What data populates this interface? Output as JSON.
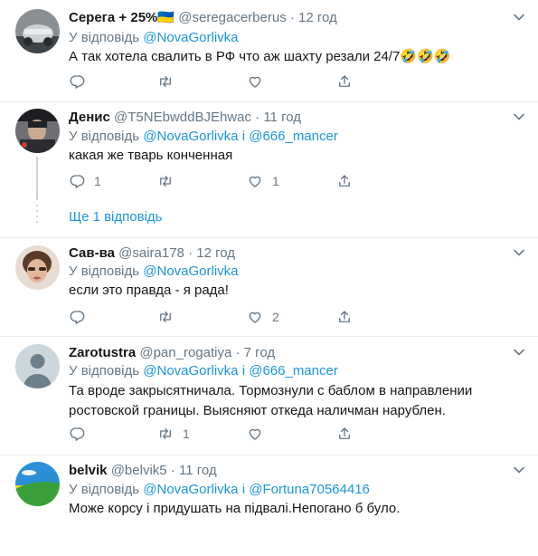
{
  "tweets": [
    {
      "name": "Серега + 25%",
      "flag": "🇺🇦",
      "handle": "@seregacerberus",
      "time": "12 год",
      "reply_prefix": "У відповідь",
      "mention1": "@NovaGorlivka",
      "text": "А так хотела свалить в РФ что аж шахту резали 24/7🤣🤣🤣",
      "reply_count": "",
      "retweet_count": "",
      "like_count": ""
    },
    {
      "name": "Денис",
      "handle": "@T5NEbwddBJEhwac",
      "time": "11 год",
      "reply_prefix": "У відповідь",
      "mention1": "@NovaGorlivka",
      "joiner": "і",
      "mention2": "@666_mancer",
      "text": "какая же тварь конченная",
      "reply_count": "1",
      "retweet_count": "",
      "like_count": "1"
    },
    {
      "name": "Сав-ва",
      "handle": "@saira178",
      "time": "12 год",
      "reply_prefix": "У відповідь",
      "mention1": "@NovaGorlivka",
      "text": "если это правда - я рада!",
      "reply_count": "",
      "retweet_count": "",
      "like_count": "2"
    },
    {
      "name": "Zarotustra",
      "handle": "@pan_rogatiya",
      "time": "7 год",
      "reply_prefix": "У відповідь",
      "mention1": "@NovaGorlivka",
      "joiner": "і",
      "mention2": "@666_mancer",
      "text": "Та вроде закрысятничала. Тормознули с баблом в направлении ростовской границы. Выясняют откеда наличман нарублен.",
      "reply_count": "",
      "retweet_count": "1",
      "like_count": ""
    },
    {
      "name": "belvik",
      "handle": "@belvik5",
      "time": "11 год",
      "reply_prefix": "У відповідь",
      "mention1": "@NovaGorlivka",
      "joiner": "і",
      "mention2": "@Fortuna70564416",
      "text": "Може корсу і придушать на підвалі.Непогано б було.",
      "reply_count": "",
      "retweet_count": "",
      "like_count": ""
    }
  ],
  "show_more_replies": "Ще 1 відповідь",
  "separator_dot": "·",
  "colors": {
    "link": "#1b95e0",
    "secondary_text": "#657786",
    "divider": "#e6ecf0"
  }
}
